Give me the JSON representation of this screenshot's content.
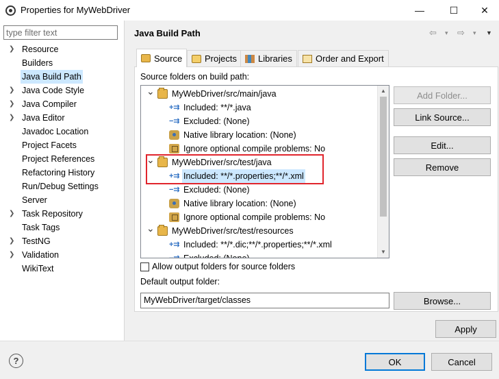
{
  "window": {
    "title": "Properties for MyWebDriver",
    "minimize_glyph": "—",
    "maximize_glyph": "☐",
    "close_glyph": "✕"
  },
  "filter": {
    "placeholder": "type filter text"
  },
  "nav": {
    "items": [
      {
        "label": "Resource",
        "expandable": true
      },
      {
        "label": "Builders",
        "expandable": false
      },
      {
        "label": "Java Build Path",
        "expandable": false,
        "selected": true
      },
      {
        "label": "Java Code Style",
        "expandable": true
      },
      {
        "label": "Java Compiler",
        "expandable": true
      },
      {
        "label": "Java Editor",
        "expandable": true
      },
      {
        "label": "Javadoc Location",
        "expandable": false
      },
      {
        "label": "Project Facets",
        "expandable": false
      },
      {
        "label": "Project References",
        "expandable": false
      },
      {
        "label": "Refactoring History",
        "expandable": false
      },
      {
        "label": "Run/Debug Settings",
        "expandable": false
      },
      {
        "label": "Server",
        "expandable": false
      },
      {
        "label": "Task Repository",
        "expandable": true
      },
      {
        "label": "Task Tags",
        "expandable": false
      },
      {
        "label": "TestNG",
        "expandable": true
      },
      {
        "label": "Validation",
        "expandable": true
      },
      {
        "label": "WikiText",
        "expandable": false
      }
    ]
  },
  "header": {
    "title": "Java Build Path",
    "back_glyph": "⇦",
    "forward_glyph": "⇨",
    "dropdown_glyph": "▾",
    "menu_glyph": "▼"
  },
  "tabs": [
    {
      "label": "Source",
      "active": true
    },
    {
      "label": "Projects",
      "active": false
    },
    {
      "label": "Libraries",
      "active": false
    },
    {
      "label": "Order and Export",
      "active": false
    }
  ],
  "source": {
    "label": "Source folders on build path:",
    "tree": [
      {
        "level": 0,
        "icon": "source-folder-icon",
        "label": "MyWebDriver/src/main/java",
        "expanded": true
      },
      {
        "level": 1,
        "icon": "inclusion-filter-icon",
        "label": "Included: **/*.java"
      },
      {
        "level": 1,
        "icon": "exclusion-filter-icon",
        "label": "Excluded: (None)"
      },
      {
        "level": 1,
        "icon": "native-library-icon",
        "label": "Native library location: (None)"
      },
      {
        "level": 1,
        "icon": "ignore-problems-icon",
        "label": "Ignore optional compile problems: No"
      },
      {
        "level": 0,
        "icon": "source-folder-icon",
        "label": "MyWebDriver/src/test/java",
        "expanded": true
      },
      {
        "level": 1,
        "icon": "inclusion-filter-icon",
        "label": "Included: **/*.properties;**/*.xml",
        "selected": true
      },
      {
        "level": 1,
        "icon": "exclusion-filter-icon",
        "label": "Excluded: (None)"
      },
      {
        "level": 1,
        "icon": "native-library-icon",
        "label": "Native library location: (None)"
      },
      {
        "level": 1,
        "icon": "ignore-problems-icon",
        "label": "Ignore optional compile problems: No"
      },
      {
        "level": 0,
        "icon": "source-folder-icon",
        "label": "MyWebDriver/src/test/resources",
        "expanded": true
      },
      {
        "level": 1,
        "icon": "inclusion-filter-icon",
        "label": "Included: **/*.dic;**/*.properties;**/*.xml"
      },
      {
        "level": 1,
        "icon": "exclusion-filter-icon",
        "label": "Excluded: (None)"
      }
    ],
    "buttons": {
      "add_folder": "Add Folder...",
      "link_source": "Link Source...",
      "edit": "Edit...",
      "remove": "Remove"
    },
    "allow_output_label": "Allow output folders for source folders",
    "allow_output_checked": false,
    "default_output_label": "Default output folder:",
    "default_output_value": "MyWebDriver/target/classes",
    "browse": "Browse..."
  },
  "footer": {
    "apply": "Apply",
    "ok": "OK",
    "cancel": "Cancel",
    "help_glyph": "?"
  }
}
